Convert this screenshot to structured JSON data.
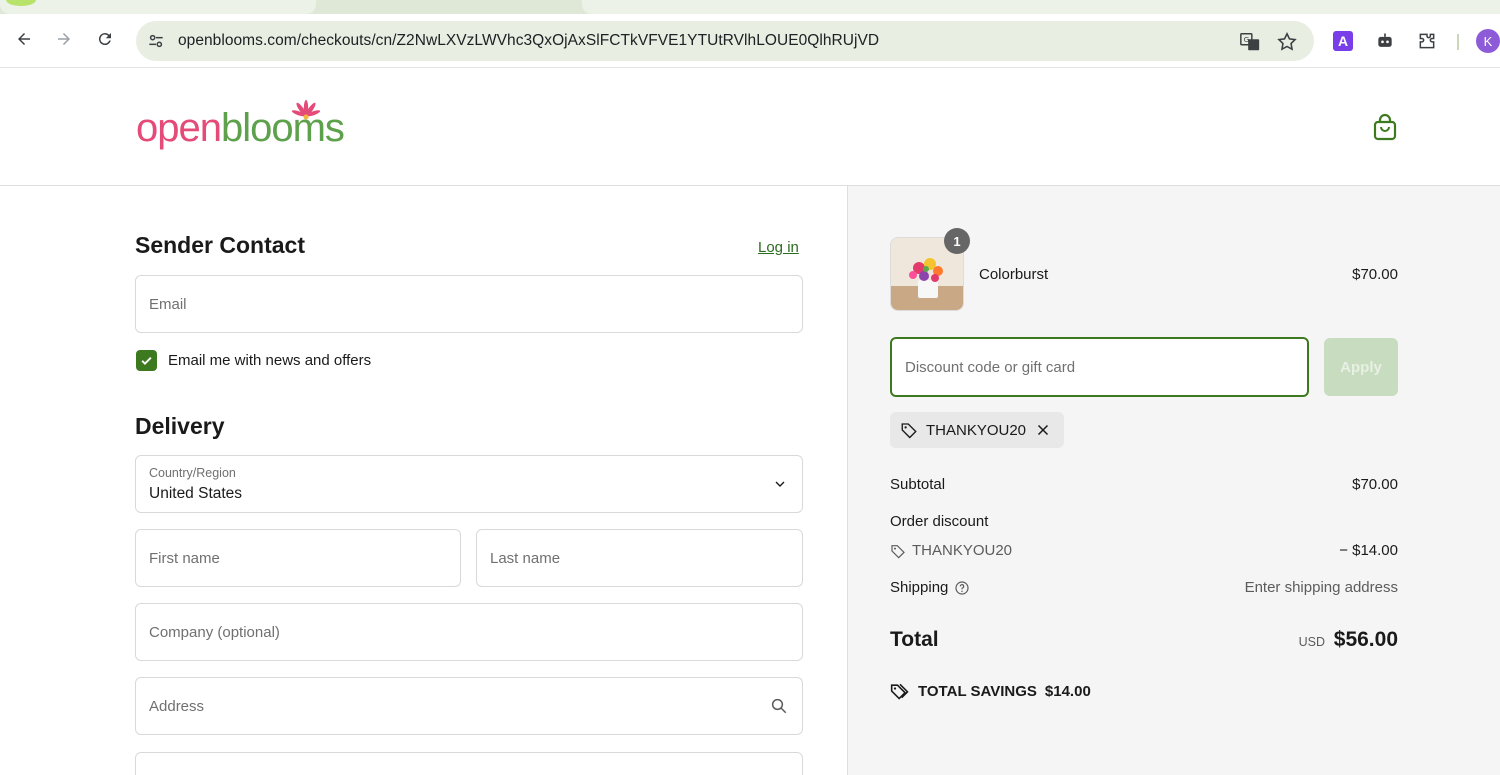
{
  "browser": {
    "url": "openblooms.com/checkouts/cn/Z2NwLXVzLWVhc3QxOjAxSlFCTkVFVE1YTUtRVlhLOUE0QlhRUjVD",
    "profile_initial": "K",
    "extension_a_label": "A"
  },
  "header": {
    "logo_open": "open",
    "logo_blooms": "blooms"
  },
  "contact": {
    "title": "Sender Contact",
    "login_label": "Log in",
    "email_placeholder": "Email",
    "newsletter_label": "Email me with news and offers",
    "newsletter_checked": true
  },
  "delivery": {
    "title": "Delivery",
    "country_label": "Country/Region",
    "country_value": "United States",
    "first_name_placeholder": "First name",
    "last_name_placeholder": "Last name",
    "company_placeholder": "Company (optional)",
    "address_placeholder": "Address"
  },
  "summary": {
    "item": {
      "name": "Colorburst",
      "price": "$70.00",
      "quantity": "1"
    },
    "discount_placeholder": "Discount code or gift card",
    "apply_label": "Apply",
    "applied_code": "THANKYOU20",
    "subtotal_label": "Subtotal",
    "subtotal_value": "$70.00",
    "order_discount_label": "Order discount",
    "order_discount_code": "THANKYOU20",
    "order_discount_value": "− $14.00",
    "shipping_label": "Shipping",
    "shipping_value": "Enter shipping address",
    "total_label": "Total",
    "total_currency": "USD",
    "total_value": "$56.00",
    "savings_label": "TOTAL SAVINGS",
    "savings_value": "$14.00"
  },
  "colors": {
    "accent_green": "#3d7a1f",
    "logo_pink": "#e54b78",
    "logo_green": "#5ea14c"
  }
}
